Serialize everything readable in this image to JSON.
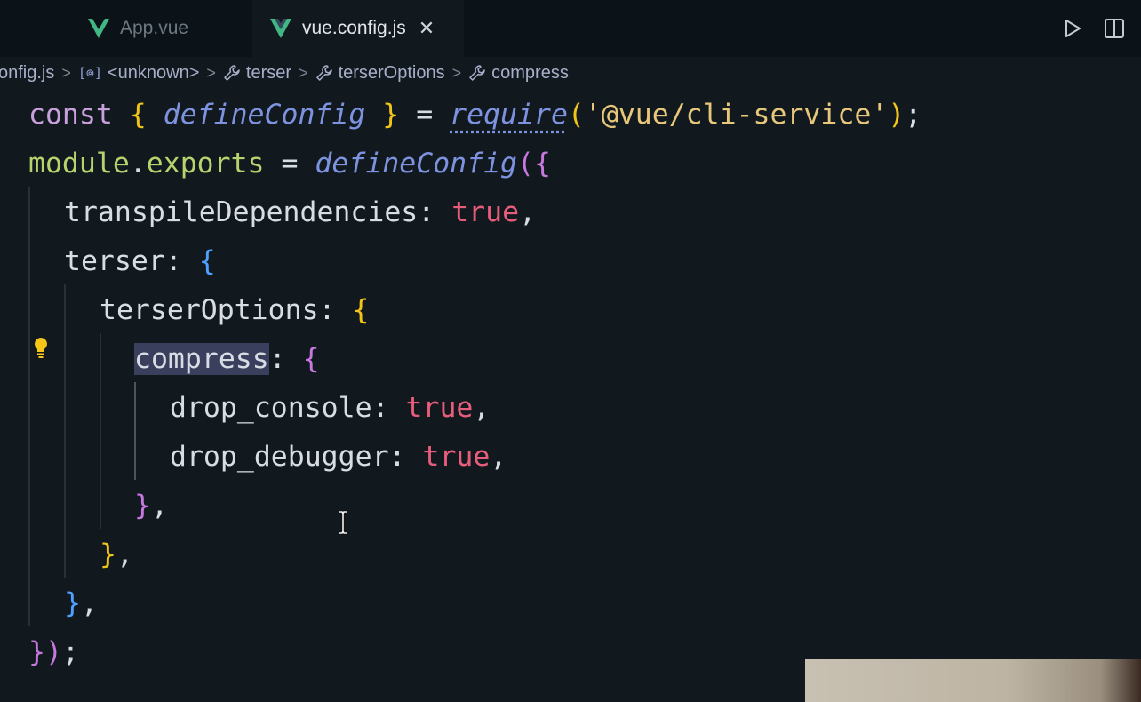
{
  "tabs": [
    {
      "label": "App.vue",
      "active": false
    },
    {
      "label": "vue.config.js",
      "active": true,
      "close": "✕"
    }
  ],
  "breadcrumb": {
    "file": "onfig.js",
    "items": [
      "<unknown>",
      "terser",
      "terserOptions",
      "compress"
    ]
  },
  "code": {
    "line1": {
      "kw": "const",
      "b1": "{",
      "name": "defineConfig",
      "b2": "}",
      "eq": "=",
      "fn": "require",
      "p1": "(",
      "str": "'@vue/cli-service'",
      "p2": ")",
      "semi": ";"
    },
    "line2": {
      "obj": "module",
      "dot": ".",
      "prop": "exports",
      "eq": "=",
      "fn": "defineConfig",
      "p1": "(",
      "b1": "{"
    },
    "line3": {
      "key": "transpileDependencies",
      "colon": ":",
      "val": "true",
      "comma": ","
    },
    "line4": {
      "key": "terser",
      "colon": ":",
      "b1": "{"
    },
    "line5": {
      "key": "terserOptions",
      "colon": ":",
      "b1": "{"
    },
    "line6": {
      "key": "compress",
      "colon": ":",
      "b1": "{"
    },
    "line7": {
      "key": "drop_console",
      "colon": ":",
      "val": "true",
      "comma": ","
    },
    "line8": {
      "key": "drop_debugger",
      "colon": ":",
      "val": "true",
      "comma": ","
    },
    "line9": {
      "b": "}",
      "comma": ","
    },
    "line10": {
      "b": "}",
      "comma": ","
    },
    "line11": {
      "b": "}",
      "comma": ","
    },
    "line12": {
      "b": "}",
      "p": ")",
      "semi": ";"
    }
  },
  "colors": {
    "background": "#11191f",
    "keyword": "#c9a0dc",
    "function": "#7d93e0",
    "string": "#e8c77a",
    "boolean": "#e85d7c",
    "vue_green": "#41b883"
  },
  "icons": [
    "vue-icon",
    "close-icon",
    "run-icon",
    "split-editor-icon",
    "wrench-icon",
    "symbol-icon",
    "lightbulb-icon",
    "text-cursor-icon"
  ]
}
